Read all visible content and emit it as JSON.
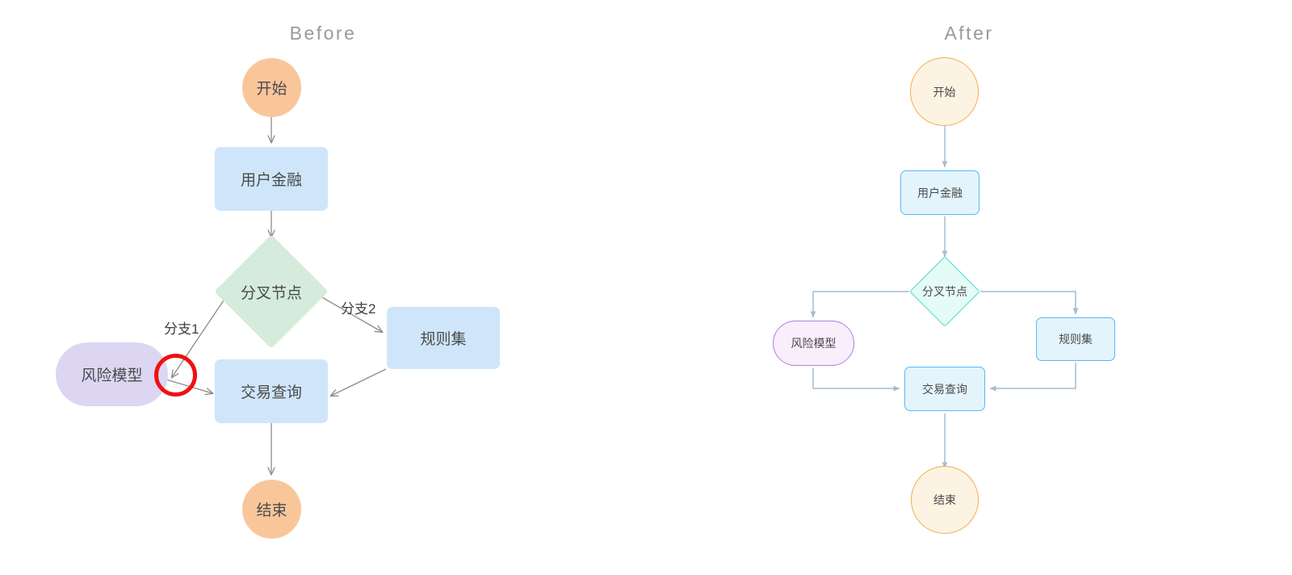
{
  "panels": [
    {
      "id": "before",
      "title": "Before",
      "style_note": "flat filled shapes, no borders, diagonal crossing edges",
      "nodes": [
        {
          "id": "start",
          "label": "开始",
          "shape": "circle"
        },
        {
          "id": "user",
          "label": "用户金融",
          "shape": "rect"
        },
        {
          "id": "fork",
          "label": "分叉节点",
          "shape": "diamond"
        },
        {
          "id": "risk",
          "label": "风险模型",
          "shape": "stadium"
        },
        {
          "id": "rules",
          "label": "规则集",
          "shape": "rect"
        },
        {
          "id": "query",
          "label": "交易查询",
          "shape": "rect"
        },
        {
          "id": "end",
          "label": "结束",
          "shape": "circle"
        }
      ],
      "edges": [
        {
          "from": "start",
          "to": "user",
          "label": ""
        },
        {
          "from": "user",
          "to": "fork",
          "label": ""
        },
        {
          "from": "fork",
          "to": "risk",
          "label": "分支1"
        },
        {
          "from": "fork",
          "to": "rules",
          "label": "分支2"
        },
        {
          "from": "risk",
          "to": "query",
          "label": ""
        },
        {
          "from": "rules",
          "to": "query",
          "label": ""
        },
        {
          "from": "query",
          "to": "end",
          "label": ""
        }
      ],
      "edge_labels": [
        {
          "text": "分支1"
        },
        {
          "text": "分支2"
        }
      ],
      "annotation": {
        "type": "highlight-circle",
        "color": "#ee1111",
        "note": "overlapping arrowheads at 风险模型 edge"
      }
    },
    {
      "id": "after",
      "title": "After",
      "style_note": "bordered pale shapes, orthogonal routed edges, no branch labels",
      "nodes": [
        {
          "id": "start",
          "label": "开始",
          "shape": "circle"
        },
        {
          "id": "user",
          "label": "用户金融",
          "shape": "rect"
        },
        {
          "id": "fork",
          "label": "分叉节点",
          "shape": "diamond"
        },
        {
          "id": "risk",
          "label": "风险模型",
          "shape": "stadium"
        },
        {
          "id": "rules",
          "label": "规则集",
          "shape": "rect"
        },
        {
          "id": "query",
          "label": "交易查询",
          "shape": "rect"
        },
        {
          "id": "end",
          "label": "结束",
          "shape": "circle"
        }
      ],
      "edges": [
        {
          "from": "start",
          "to": "user",
          "label": ""
        },
        {
          "from": "user",
          "to": "fork",
          "label": ""
        },
        {
          "from": "fork",
          "to": "risk",
          "label": ""
        },
        {
          "from": "fork",
          "to": "rules",
          "label": ""
        },
        {
          "from": "risk",
          "to": "query",
          "label": ""
        },
        {
          "from": "rules",
          "to": "query",
          "label": ""
        },
        {
          "from": "query",
          "to": "end",
          "label": ""
        }
      ],
      "edge_labels": [],
      "annotation": null
    }
  ],
  "colors": {
    "background": "#ffffff",
    "title_text": "#9a9a9a",
    "node_text": "#4a4a4a",
    "before_circle_fill": "#f9c69a",
    "before_rect_fill": "#cfe6fa",
    "before_stadium_fill": "#ddd6f3",
    "before_diamond_fill": "#d5ebdc",
    "before_edge_stroke": "#8c8c8c",
    "after_circle_fill": "#fdf3e3",
    "after_circle_border": "#f0ad52",
    "after_rect_fill": "#e4f4fd",
    "after_rect_border": "#56baf5",
    "after_stadium_fill": "#f9eefc",
    "after_stadium_border": "#b07fd8",
    "after_diamond_fill": "#e4fbf7",
    "after_diamond_border": "#4fd8d0",
    "after_edge_stroke": "#a7bccd",
    "annotation_red": "#ee1111"
  }
}
